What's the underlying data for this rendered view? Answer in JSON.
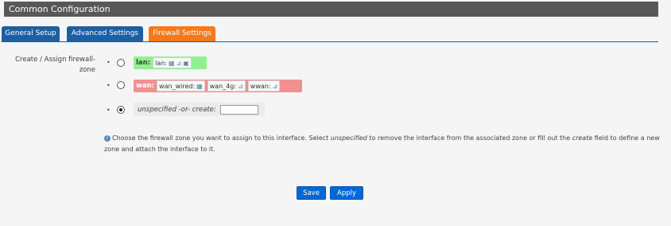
{
  "header": {
    "title": "Common Configuration"
  },
  "tabs": [
    {
      "label": "General Setup",
      "active": false
    },
    {
      "label": "Advanced Settings",
      "active": false
    },
    {
      "label": "Firewall Settings",
      "active": true
    }
  ],
  "field": {
    "label": "Create / Assign firewall-zone"
  },
  "options": {
    "lan": {
      "zone": "lan:",
      "chips": [
        {
          "label": "lan:",
          "icons": [
            "network-icon",
            "wireless-icon",
            "ethernet-icon"
          ]
        }
      ],
      "selected": false
    },
    "wan": {
      "zone": "wan:",
      "chips": [
        {
          "label": "wan_wired:",
          "icons": [
            "network-icon"
          ]
        },
        {
          "label": "wan_4g:",
          "icons": [
            "wireless-icon"
          ]
        },
        {
          "label": "wwan:",
          "icons": [
            "wireless-icon"
          ]
        }
      ],
      "selected": false
    },
    "create": {
      "label": "unspecified -or- create:",
      "value": "",
      "selected": true
    }
  },
  "help": {
    "part1": "Choose the firewall zone you want to assign to this interface. Select ",
    "em1": "unspecified",
    "part2": " to remove the interface from the associated zone or fill out the ",
    "em2": "create",
    "part3": " field to define a new zone and attach the interface to it."
  },
  "buttons": {
    "save": "Save",
    "apply": "Apply"
  },
  "colors": {
    "tab_blue": "#1c5fa3",
    "tab_active": "#f27a1e",
    "lan_zone": "#90f090",
    "wan_zone": "#f09090",
    "button": "#0069d6"
  }
}
